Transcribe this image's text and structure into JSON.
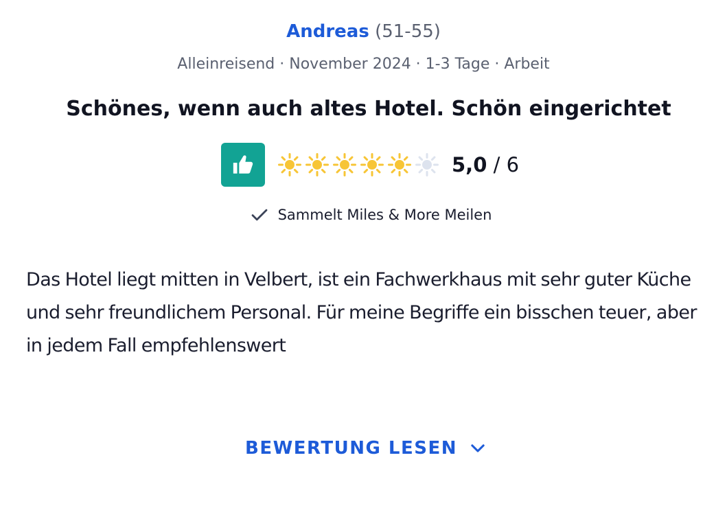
{
  "reviewer": {
    "name": "Andreas",
    "age_range": "(51-55)"
  },
  "trip_meta": "Alleinreisend · November 2024 · 1-3 Tage · Arbeit",
  "review": {
    "title": "Schönes, wenn auch altes Hotel. Schön eingerichtet",
    "score": "5,0",
    "score_separator": "/",
    "score_max": "6",
    "suns_filled": 5,
    "suns_total": 6,
    "text": "Das Hotel liegt mitten in Velbert, ist ein Fachwerkhaus mit sehr guter Küche und sehr freundlichem Personal. Für meine Begriffe ein bisschen teuer, aber in jedem Fall empfehlenswert"
  },
  "badge": {
    "label": "Sammelt Miles & More Meilen"
  },
  "actions": {
    "read_more": "BEWERTUNG LESEN"
  },
  "icons": {
    "recommend": "thumbs-up-icon",
    "rating": "sun-icon",
    "badge": "checkmark-icon",
    "expand": "chevron-down-icon"
  },
  "colors": {
    "link_blue": "#1d5bd8",
    "recommend_green": "#12a394",
    "sun_filled": "#f7c536",
    "sun_empty": "#dde3ee"
  }
}
